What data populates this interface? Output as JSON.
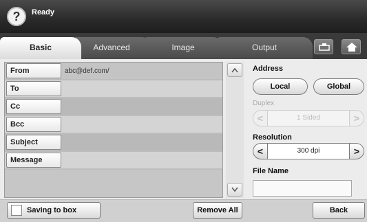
{
  "header": {
    "status": "Ready",
    "help_icon": "question-mark-icon"
  },
  "tabs": [
    {
      "label": "Basic",
      "active": true
    },
    {
      "label": "Advanced",
      "active": false
    },
    {
      "label": "Image",
      "active": false
    },
    {
      "label": "Output",
      "active": false
    }
  ],
  "toolbar_icons": [
    "job-status-icon",
    "home-icon"
  ],
  "fields": [
    {
      "label": "From",
      "value": "abc@def.com/"
    },
    {
      "label": "To",
      "value": ""
    },
    {
      "label": "Cc",
      "value": ""
    },
    {
      "label": "Bcc",
      "value": ""
    },
    {
      "label": "Subject",
      "value": ""
    },
    {
      "label": "Message",
      "value": ""
    }
  ],
  "address": {
    "label": "Address",
    "local": "Local",
    "global": "Global"
  },
  "duplex": {
    "label": "Duplex",
    "value": "1 Sided",
    "enabled": false
  },
  "resolution": {
    "label": "Resolution",
    "value": "300 dpi"
  },
  "file_name": {
    "label": "File Name",
    "value": ""
  },
  "bottom": {
    "save_label": "Saving to box",
    "remove_all": "Remove All",
    "back": "Back"
  },
  "colors": {
    "header_dark": "#2a2a2a",
    "panel": "#ececec",
    "row_alt": "#bdbdbd"
  }
}
